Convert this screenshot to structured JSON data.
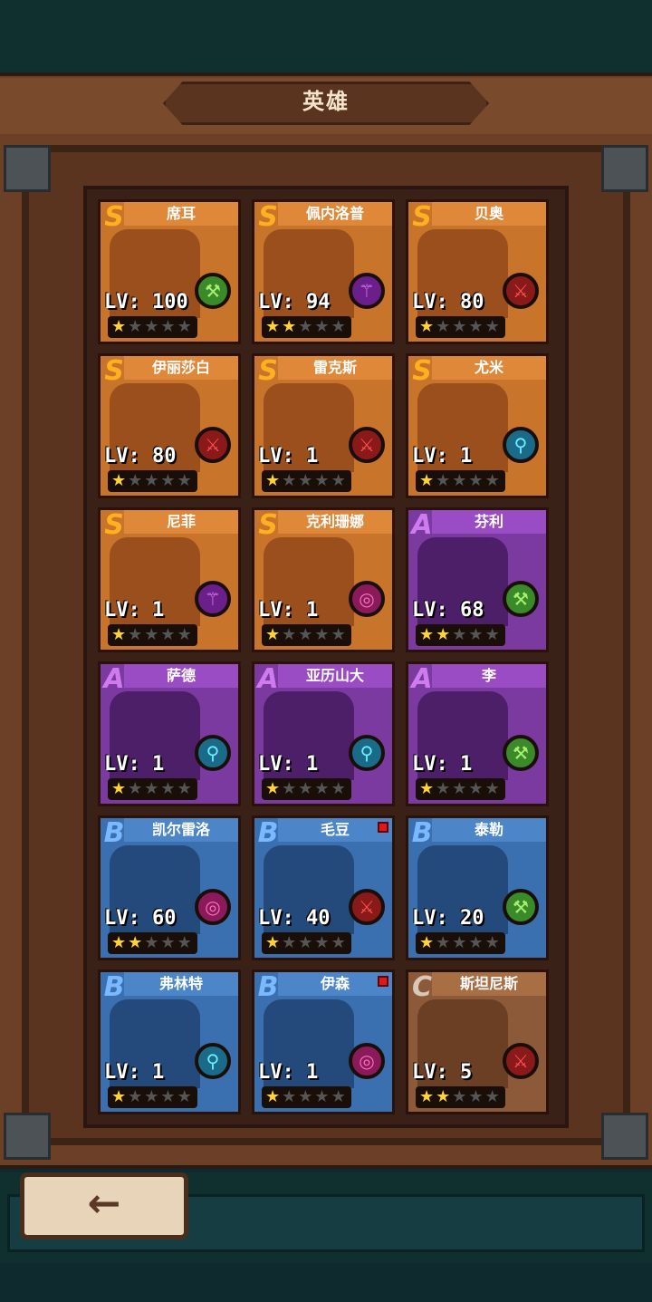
{
  "screen": {
    "title": "英雄",
    "back_icon": "←"
  },
  "colors": {
    "S": "#c9742b",
    "A": "#7a3aa0",
    "B": "#3a6fb0",
    "C": "#8c5a38"
  },
  "heroes": [
    {
      "name": "席耳",
      "rank": "S",
      "level": "LV: 100",
      "element": "green",
      "element_icon": "⚒",
      "stars": 1,
      "new": false
    },
    {
      "name": "佩内洛普",
      "rank": "S",
      "level": "LV: 94",
      "element": "purple",
      "element_icon": "⚚",
      "stars": 2,
      "new": false
    },
    {
      "name": "贝奥",
      "rank": "S",
      "level": "LV: 80",
      "element": "red",
      "element_icon": "⚔",
      "stars": 1,
      "new": false
    },
    {
      "name": "伊丽莎白",
      "rank": "S",
      "level": "LV: 80",
      "element": "red",
      "element_icon": "⚔",
      "stars": 1,
      "new": false
    },
    {
      "name": "雷克斯",
      "rank": "S",
      "level": "LV: 1",
      "element": "red",
      "element_icon": "⚔",
      "stars": 1,
      "new": false
    },
    {
      "name": "尤米",
      "rank": "S",
      "level": "LV: 1",
      "element": "cyan",
      "element_icon": "⚲",
      "stars": 1,
      "new": false
    },
    {
      "name": "尼菲",
      "rank": "S",
      "level": "LV: 1",
      "element": "purple",
      "element_icon": "⚚",
      "stars": 1,
      "new": false
    },
    {
      "name": "克利珊娜",
      "rank": "S",
      "level": "LV: 1",
      "element": "pink",
      "element_icon": "◎",
      "stars": 1,
      "new": false
    },
    {
      "name": "芬利",
      "rank": "A",
      "level": "LV: 68",
      "element": "green",
      "element_icon": "⚒",
      "stars": 2,
      "new": false
    },
    {
      "name": "萨德",
      "rank": "A",
      "level": "LV: 1",
      "element": "cyan",
      "element_icon": "⚲",
      "stars": 1,
      "new": false
    },
    {
      "name": "亚历山大",
      "rank": "A",
      "level": "LV: 1",
      "element": "cyan",
      "element_icon": "⚲",
      "stars": 1,
      "new": false
    },
    {
      "name": "李",
      "rank": "A",
      "level": "LV: 1",
      "element": "green",
      "element_icon": "⚒",
      "stars": 1,
      "new": false
    },
    {
      "name": "凯尔雷洛",
      "rank": "B",
      "level": "LV: 60",
      "element": "pink",
      "element_icon": "◎",
      "stars": 2,
      "new": false
    },
    {
      "name": "毛豆",
      "rank": "B",
      "level": "LV: 40",
      "element": "red",
      "element_icon": "⚔",
      "stars": 1,
      "new": true
    },
    {
      "name": "泰勒",
      "rank": "B",
      "level": "LV: 20",
      "element": "green",
      "element_icon": "⚒",
      "stars": 1,
      "new": false
    },
    {
      "name": "弗林特",
      "rank": "B",
      "level": "LV: 1",
      "element": "cyan",
      "element_icon": "⚲",
      "stars": 1,
      "new": false
    },
    {
      "name": "伊森",
      "rank": "B",
      "level": "LV: 1",
      "element": "pink",
      "element_icon": "◎",
      "stars": 1,
      "new": true
    },
    {
      "name": "斯坦尼斯",
      "rank": "C",
      "level": "LV: 5",
      "element": "red",
      "element_icon": "⚔",
      "stars": 2,
      "new": false
    }
  ]
}
